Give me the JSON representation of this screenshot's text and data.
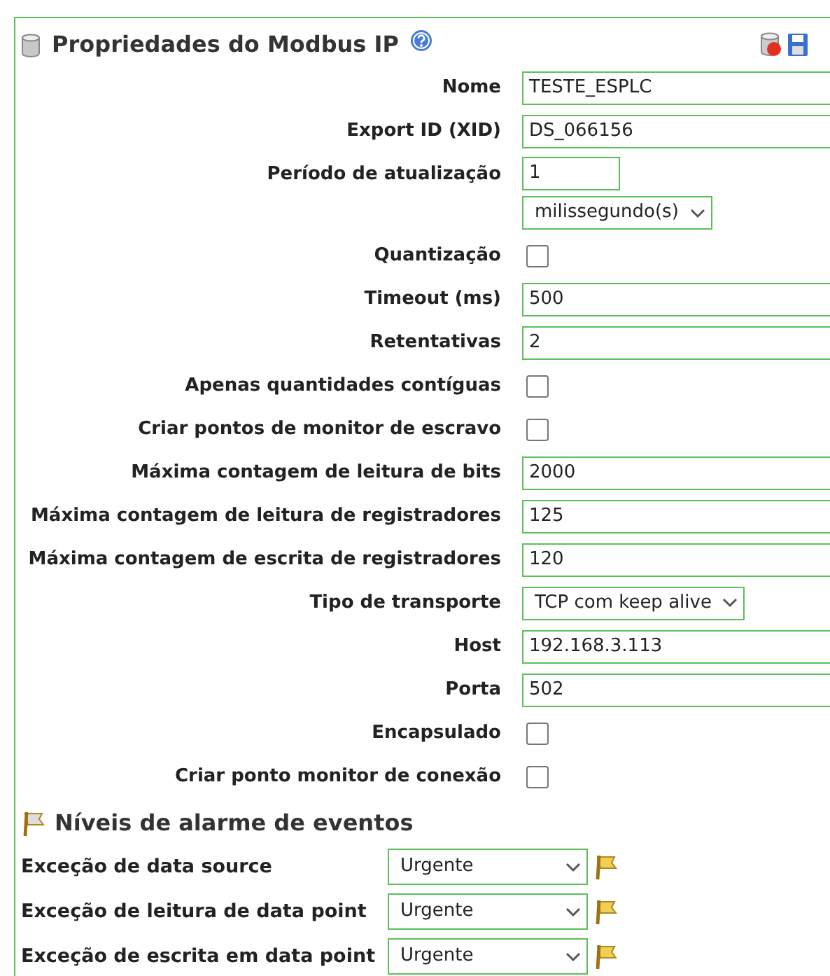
{
  "panel": {
    "title": "Propriedades do Modbus IP"
  },
  "fields": [
    {
      "kind": "text",
      "label": "Nome",
      "value": "TESTE_ESPLC"
    },
    {
      "kind": "text",
      "label": "Export ID (XID)",
      "value": "DS_066156"
    },
    {
      "kind": "period",
      "label": "Período de atualização",
      "value": "1",
      "unit": "milissegundo(s)"
    },
    {
      "kind": "checkbox",
      "label": "Quantização",
      "checked": false
    },
    {
      "kind": "text",
      "label": "Timeout (ms)",
      "value": "500"
    },
    {
      "kind": "text",
      "label": "Retentativas",
      "value": "2"
    },
    {
      "kind": "checkbox",
      "label": "Apenas quantidades contíguas",
      "checked": false
    },
    {
      "kind": "checkbox",
      "label": "Criar pontos de monitor de escravo",
      "checked": false
    },
    {
      "kind": "text",
      "label": "Máxima contagem de leitura de bits",
      "value": "2000"
    },
    {
      "kind": "text",
      "label": "Máxima contagem de leitura de registradores",
      "value": "125"
    },
    {
      "kind": "text",
      "label": "Máxima contagem de escrita de registradores",
      "value": "120"
    },
    {
      "kind": "select",
      "label": "Tipo de transporte",
      "value": "TCP com keep alive"
    },
    {
      "kind": "text",
      "label": "Host",
      "value": "192.168.3.113"
    },
    {
      "kind": "text",
      "label": "Porta",
      "value": "502"
    },
    {
      "kind": "checkbox",
      "label": "Encapsulado",
      "checked": false
    },
    {
      "kind": "checkbox",
      "label": "Criar ponto monitor de conexão",
      "checked": false
    }
  ],
  "alarms": {
    "title": "Níveis de alarme de eventos",
    "items": [
      {
        "label": "Exceção de data source",
        "value": "Urgente"
      },
      {
        "label": "Exceção de leitura de data point",
        "value": "Urgente"
      },
      {
        "label": "Exceção de escrita em data point",
        "value": "Urgente"
      }
    ]
  }
}
